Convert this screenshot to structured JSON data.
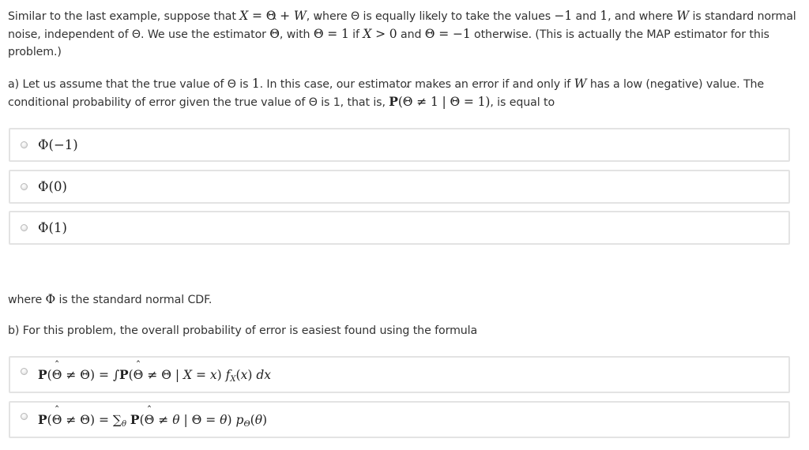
{
  "intro": {
    "t1": "Similar to the last example, suppose that ",
    "m_X": "X",
    "m_eq1": " = Θ + ",
    "m_W": "W",
    "t2": ", where Θ is equally likely to take the values ",
    "m_neg1": "−1",
    "t3": " and ",
    "m_1": "1",
    "t4": ", and where ",
    "m_W2": "W",
    "t5": " is standard normal noise, independent of Θ. We use the estimator ",
    "t6": ", with ",
    "m_eq2": " = 1",
    "t7": " if ",
    "m_X2": "X",
    "m_gt": " > 0",
    "t8": " and ",
    "m_eq3": " = −1",
    "t9": " otherwise. (This is actually the MAP estimator for this problem.)"
  },
  "hat_symbol": "Θ",
  "hat_mark": "ˆ",
  "part_a": {
    "t1": "a) Let us assume that the true value of Θ is ",
    "m_1": "1",
    "t2": ". In this case, our estimator makes an error if and only if ",
    "m_W": "W",
    "t3": " has a low (negative) value. The conditional probability of error given the true value of Θ is 1, that is, ",
    "m_P": "P",
    "m_rest": "( ≠ 1 | Θ = 1)",
    "t4": ", is equal to"
  },
  "options_a": [
    "Φ(−1)",
    "Φ(0)",
    "Φ(1)"
  ],
  "where_line": {
    "t1": "where ",
    "m_phi": "Φ",
    "t2": " is the standard normal CDF."
  },
  "part_b": {
    "text": "b) For this problem, the overall probability of error is easiest found using the formula"
  },
  "options_b": [
    {
      "lhs_open": "P(",
      "lhs_close": " ≠ Θ) = ∫",
      "rhs_P": "P(",
      "rhs_rest": " ≠ Θ | X = x) f",
      "sub": "X",
      "tail": "(x) dx"
    },
    {
      "lhs_open": "P(",
      "lhs_close": " ≠ Θ) = ∑",
      "sub1": "θ",
      "rhs_P": " P(",
      "rhs_rest": " ≠ θ | Θ = θ) p",
      "sub": "Θ",
      "tail": "(θ)"
    }
  ]
}
